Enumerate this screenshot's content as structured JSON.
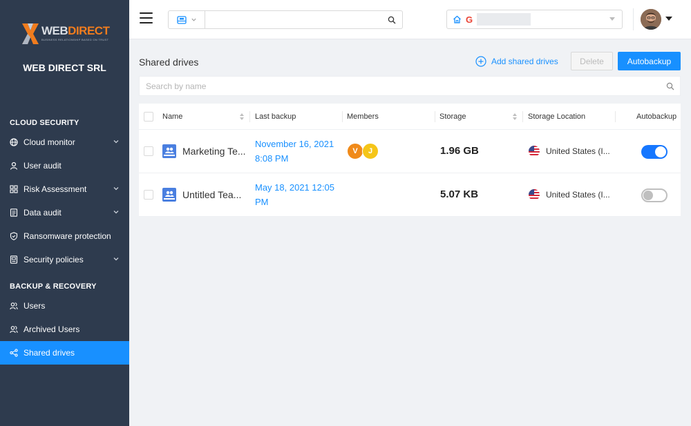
{
  "brand": {
    "logo_word1": "WEB",
    "logo_word2": "DIRECT",
    "logo_tagline": "BUSINESS RELATIONSHIP BASED ON TRUST",
    "org_name": "WEB DIRECT SRL",
    "accent_color": "#1890ff"
  },
  "sidebar": {
    "cloud_security_title": "CLOUD SECURITY",
    "backup_recovery_title": "BACKUP & RECOVERY",
    "items": [
      {
        "label": "Cloud monitor",
        "icon": "globe-icon",
        "expandable": true
      },
      {
        "label": "User audit",
        "icon": "user-icon",
        "expandable": false
      },
      {
        "label": "Risk Assessment",
        "icon": "grid-icon",
        "expandable": true
      },
      {
        "label": "Data audit",
        "icon": "document-icon",
        "expandable": true
      },
      {
        "label": "Ransomware protection",
        "icon": "shield-icon",
        "expandable": false
      },
      {
        "label": "Security policies",
        "icon": "policy-icon",
        "expandable": true
      },
      {
        "label": "Users",
        "icon": "users-icon",
        "expandable": false
      },
      {
        "label": "Archived Users",
        "icon": "archived-users-icon",
        "expandable": false
      },
      {
        "label": "Shared drives",
        "icon": "share-icon",
        "expandable": false,
        "active": true
      }
    ]
  },
  "topbar": {
    "search_value": "",
    "tenant_provider": "G"
  },
  "main": {
    "title": "Shared drives",
    "add_label": "Add shared drives",
    "delete_label": "Delete",
    "autobackup_label": "Autobackup",
    "search_placeholder": "Search by name"
  },
  "table": {
    "headers": {
      "name": "Name",
      "last_backup": "Last backup",
      "members": "Members",
      "storage": "Storage",
      "location": "Storage Location",
      "autobackup": "Autobackup"
    },
    "rows": [
      {
        "name": "Marketing Te...",
        "backup_line1": "November 16, 2021",
        "backup_line2": "8:08 PM",
        "members": [
          {
            "initial": "V",
            "color": "#f08a1a"
          },
          {
            "initial": "J",
            "color": "#f5c518"
          }
        ],
        "storage": "1.96 GB",
        "location": "United States (I...",
        "autobackup": true
      },
      {
        "name": "Untitled Tea...",
        "backup_line1": "May 18, 2021 12:05",
        "backup_line2": "PM",
        "members": [],
        "storage": "5.07 KB",
        "location": "United States (I...",
        "autobackup": false
      }
    ]
  }
}
